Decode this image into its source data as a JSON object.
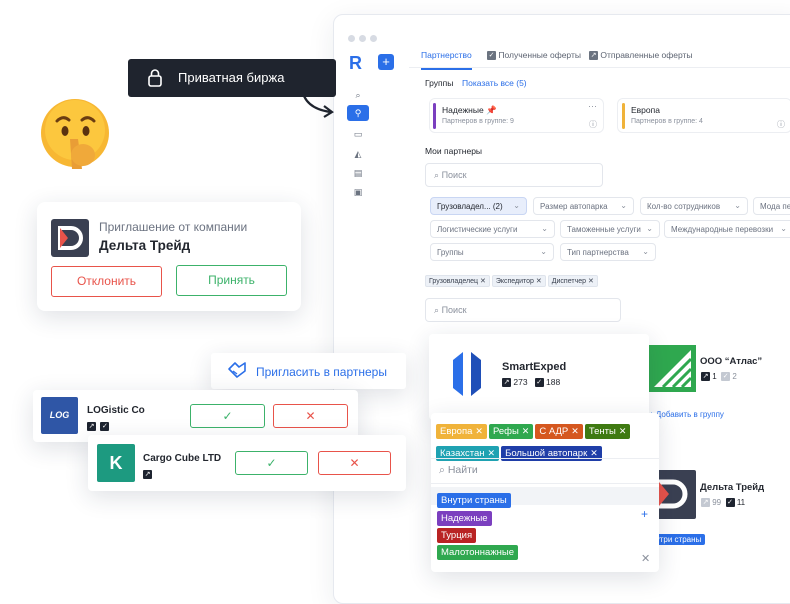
{
  "tooltip": {
    "label": "Приватная биржа"
  },
  "invite": {
    "from_label": "Приглашение от компании",
    "company": "Дельта Трейд",
    "reject_label": "Отклонить",
    "accept_label": "Принять"
  },
  "invite_partners": {
    "label": "Пригласить в партнеры"
  },
  "invites": [
    {
      "name": "LOGistic Co",
      "logo_text": "LOG"
    },
    {
      "name": "Cargo Cube LTD",
      "logo_text": "K"
    }
  ],
  "app": {
    "tabs": [
      "Партнерство",
      "Полученные оферты",
      "Отправленные оферты"
    ],
    "groups": {
      "title": "Группы",
      "show_all": "Показать все (5)"
    },
    "group_cards": [
      {
        "name": "Надежные",
        "count_label": "Партнеров в группе: 9",
        "color": "#7b3fbf"
      },
      {
        "name": "Европа",
        "count_label": "Партнеров в группе: 4",
        "color": "#f0b33a"
      }
    ],
    "my_partners": "Мои партнеры",
    "search_placeholder": "Поиск",
    "filters": [
      "Грузовладел... (2)",
      "Размер автопарка",
      "Кол-во сотрудников",
      "Мода пе",
      "Логистические услуги",
      "Таможенные услуги",
      "Международные перевозки",
      "Группы",
      "Тип партнерства"
    ],
    "chips": [
      "Грузовладелец",
      "Экспедитор",
      "Диспетчер"
    ],
    "search2_placeholder": "Поиск"
  },
  "partners": [
    {
      "name": "SmartExped",
      "stat1": "273",
      "stat2": "188"
    },
    {
      "name": "ООО “Атлас”",
      "stat1": "1",
      "stat2": "2",
      "action": "Добавить в группу"
    },
    {
      "name": "Дельта Трейд",
      "stat1": "99",
      "stat2": "11",
      "tag": "Внутри страны"
    }
  ],
  "tag_picker": {
    "selected": [
      {
        "label": "Европа",
        "color": "#f0b33a"
      },
      {
        "label": "Рефы",
        "color": "#2fa84f"
      },
      {
        "label": "С АДР",
        "color": "#d5571f"
      },
      {
        "label": "Тенты",
        "color": "#3f7a12"
      },
      {
        "label": "Казахстан",
        "color": "#1fa2b2"
      },
      {
        "label": "Большой автопарк",
        "color": "#1f3ea8"
      }
    ],
    "search_placeholder": "Найти",
    "options": [
      {
        "label": "Внутри страны",
        "color": "#2b6fe8"
      },
      {
        "label": "Надежные",
        "color": "#7b3fbf"
      },
      {
        "label": "Турция",
        "color": "#b92323"
      },
      {
        "label": "Малотоннажные",
        "color": "#2fa84f"
      }
    ]
  },
  "colors": {
    "accent": "#2b6fe8",
    "success": "#3cb26a",
    "danger": "#e8534a",
    "dark": "#23272f"
  },
  "icons": [
    "lock-icon",
    "shush-emoji-icon",
    "handshake-icon",
    "check-icon",
    "close-icon",
    "search-icon",
    "plus-icon"
  ]
}
